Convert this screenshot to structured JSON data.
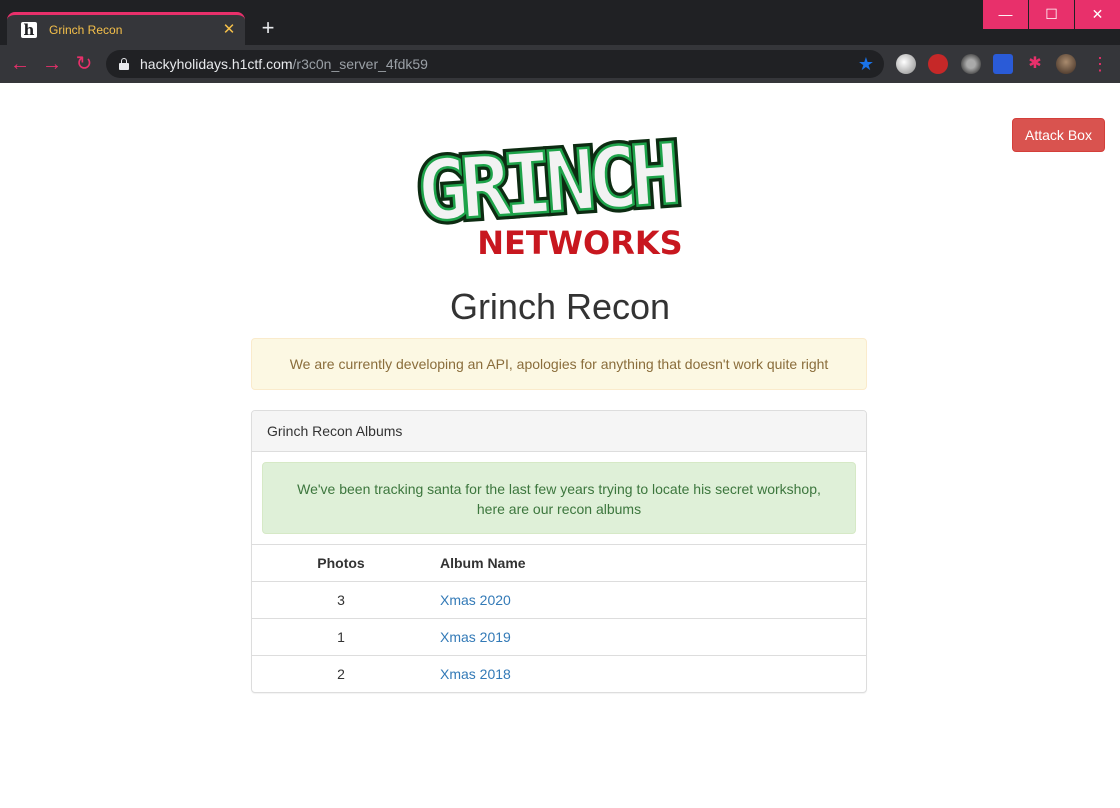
{
  "browser": {
    "tab_title": "Grinch Recon",
    "tab_favicon_letter": "h",
    "tab_close": "✕",
    "new_tab": "+",
    "window_controls": {
      "minimize": "—",
      "maximize": "☐",
      "close": "✕"
    },
    "url_host": "hackyholidays.h1ctf.com",
    "url_path": "/r3c0n_server_4fdk59",
    "nav": {
      "back": "←",
      "forward": "→",
      "reload": "↻"
    },
    "star": "★",
    "extensions_icon": "✱",
    "menu": "⋮",
    "colors": {
      "accent": "#e8306b",
      "tab_text": "#f5c04a",
      "frame": "#202124",
      "toolbar": "#35363a"
    }
  },
  "page": {
    "attack_box_label": "Attack Box",
    "logo": {
      "top_text": "GRINCH",
      "bottom_text": "NETWORKS"
    },
    "title": "Grinch Recon",
    "warning": "We are currently developing an API, apologies for anything that doesn't work quite right",
    "panel": {
      "heading": "Grinch Recon Albums",
      "info": "We've been tracking santa for the last few years trying to locate his secret workshop, here are our recon albums",
      "columns": {
        "photos": "Photos",
        "album_name": "Album Name"
      },
      "rows": [
        {
          "photos": "3",
          "name": "Xmas 2020"
        },
        {
          "photos": "1",
          "name": "Xmas 2019"
        },
        {
          "photos": "2",
          "name": "Xmas 2018"
        }
      ]
    },
    "colors": {
      "danger": "#d9534f",
      "link": "#337ab7",
      "logo_green": "#1ea34a",
      "logo_red": "#c8171f"
    }
  }
}
